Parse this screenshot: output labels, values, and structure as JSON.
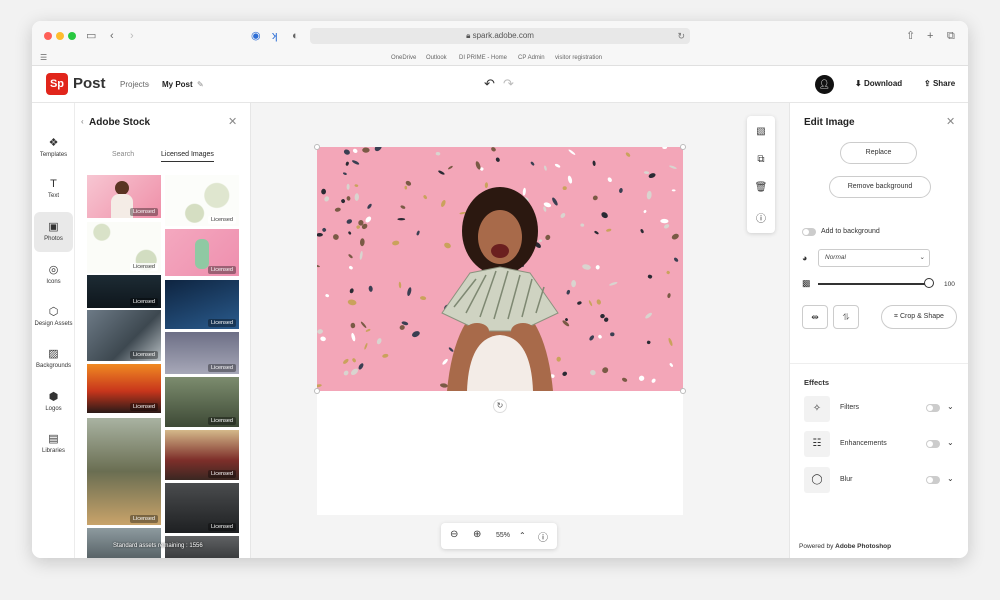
{
  "browser": {
    "url": "spark.adobe.com",
    "favorites": [
      "OneDrive",
      "Outlook",
      "DI PRIME - Home",
      "CP Admin",
      "visitor registration"
    ]
  },
  "app": {
    "logo_text": "Sp",
    "name": "Post",
    "breadcrumb": [
      "Projects",
      "My Post"
    ],
    "download_label": "Download",
    "share_label": "Share"
  },
  "rail": {
    "items": [
      {
        "label": "Templates",
        "icon": "templates-icon"
      },
      {
        "label": "Text",
        "icon": "text-icon"
      },
      {
        "label": "Photos",
        "icon": "photos-icon",
        "active": true
      },
      {
        "label": "Icons",
        "icon": "icons-icon"
      },
      {
        "label": "Design Assets",
        "icon": "design-assets-icon"
      },
      {
        "label": "Backgrounds",
        "icon": "backgrounds-icon"
      },
      {
        "label": "Logos",
        "icon": "logos-icon"
      },
      {
        "label": "Libraries",
        "icon": "libraries-icon"
      }
    ]
  },
  "stock": {
    "title": "Adobe Stock",
    "tabs": [
      {
        "label": "Search",
        "active": false
      },
      {
        "label": "Licensed Images",
        "active": true
      }
    ],
    "badge": "Licensed",
    "remaining": "Standard assets remaining : 1556"
  },
  "canvas": {
    "zoom": "55%"
  },
  "edit": {
    "title": "Edit Image",
    "replace_label": "Replace",
    "remove_bg_label": "Remove background",
    "add_to_bg_label": "Add to background",
    "blend_mode": "Normal",
    "opacity": "100",
    "crop_label": "Crop & Shape",
    "effects_title": "Effects",
    "effects": [
      {
        "label": "Filters",
        "icon": "magic-wand-icon"
      },
      {
        "label": "Enhancements",
        "icon": "sliders-icon"
      },
      {
        "label": "Blur",
        "icon": "droplet-icon"
      }
    ],
    "powered_prefix": "Powered by ",
    "powered_brand": "Adobe Photoshop"
  },
  "colors": {
    "accent": "#e1251b",
    "photo_bg": "#f3a6b8"
  }
}
